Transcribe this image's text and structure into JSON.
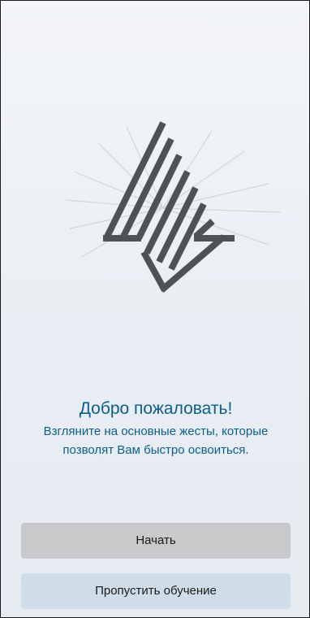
{
  "welcome": {
    "title": "Добро пожаловать!",
    "text": "Взгляните на основные жесты, которые позволят Вам быстро освоиться."
  },
  "buttons": {
    "start_label": "Начать",
    "skip_label": "Пропустить обучение"
  },
  "logo": {
    "icon": "triangle-stripes-logo-icon",
    "color": "#4f5254"
  },
  "colors": {
    "accent_text": "#0b5f8a",
    "start_button_bg": "#c9c9cb",
    "skip_button_bg": "#cfdde8"
  }
}
